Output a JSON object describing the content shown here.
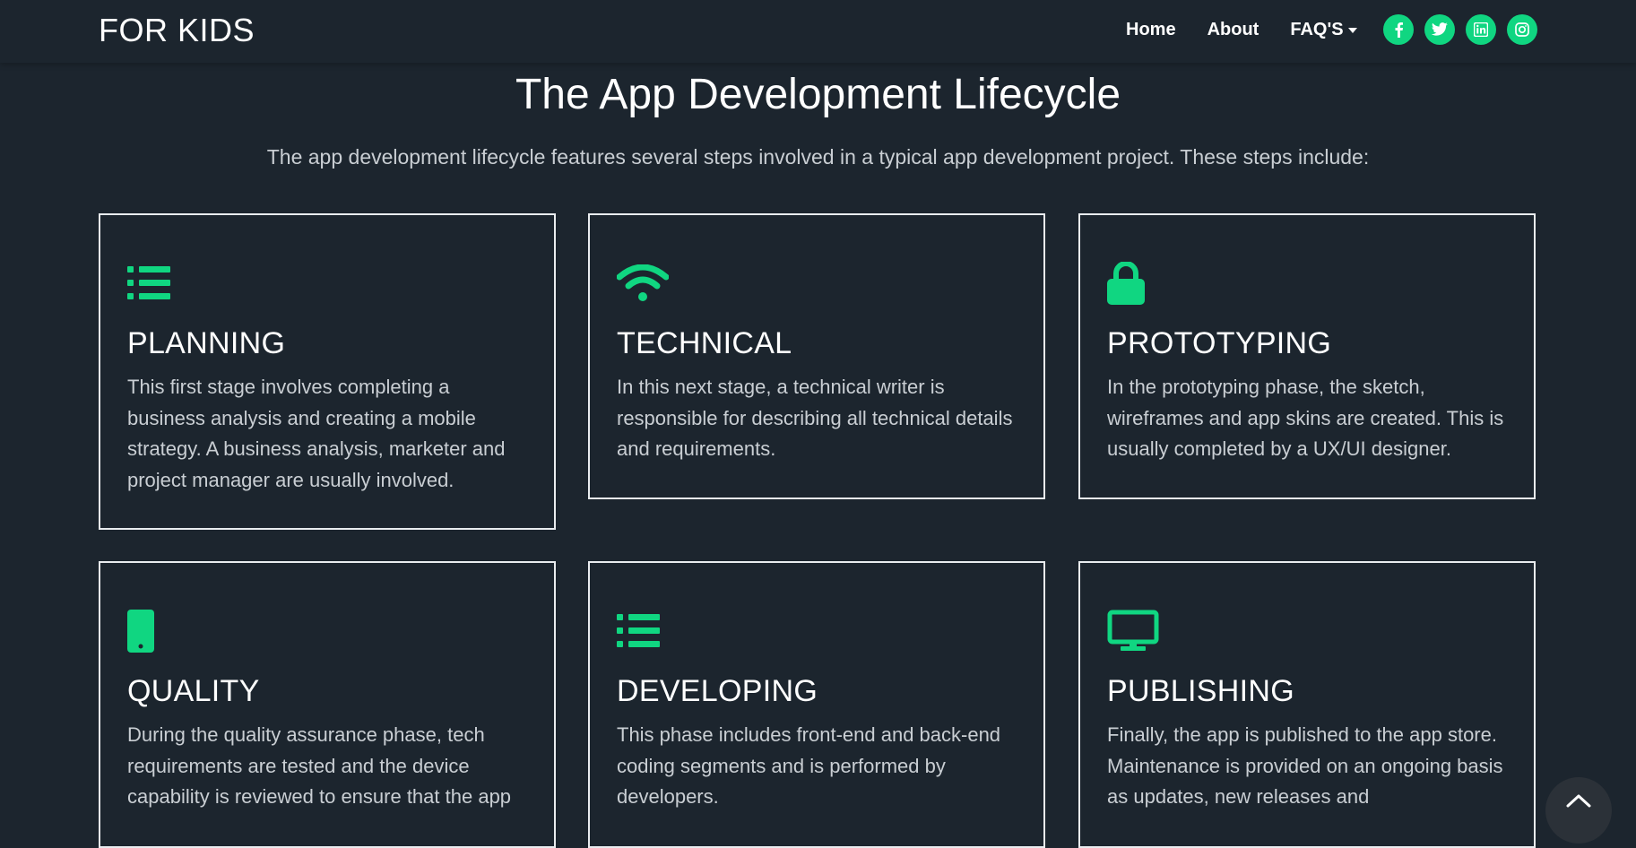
{
  "navbar": {
    "brand": "FOR KIDS",
    "links": {
      "home": "Home",
      "about": "About",
      "faqs": "FAQ'S"
    },
    "socials": [
      "facebook-icon",
      "twitter-icon",
      "linkedin-icon",
      "instagram-icon"
    ]
  },
  "section": {
    "title": "The App Development Lifecycle",
    "intro": "The app development lifecycle features several steps involved in a typical app development project. These steps include:"
  },
  "cards": [
    {
      "icon": "list-icon",
      "title": "PLANNING",
      "text": "This first stage involves completing a business analysis and creating a mobile strategy. A business analysis, marketer and project manager are usually involved."
    },
    {
      "icon": "wifi-icon",
      "title": "TECHNICAL",
      "text": "In this next stage, a technical writer is responsible for describing all technical details and requirements."
    },
    {
      "icon": "lock-icon",
      "title": "PROTOTYPING",
      "text": "In the prototyping phase, the sketch, wireframes and app skins are created. This is usually completed by a UX/UI designer."
    },
    {
      "icon": "mobile-icon",
      "title": "QUALITY",
      "text": "During the quality assurance phase, tech requirements are tested and the device capability is reviewed to ensure that the app"
    },
    {
      "icon": "list-icon",
      "title": "DEVELOPING",
      "text": "This phase includes front-end and back-end coding segments and is performed by developers."
    },
    {
      "icon": "desktop-icon",
      "title": "PUBLISHING",
      "text": "Finally, the app is published to the app store. Maintenance is provided on an ongoing basis as updates, new releases and"
    }
  ],
  "colors": {
    "background": "#1c252e",
    "accent": "#10d681",
    "text": "#ffffff",
    "muted_text": "#c9ced3",
    "card_border": "#e9ecef"
  }
}
